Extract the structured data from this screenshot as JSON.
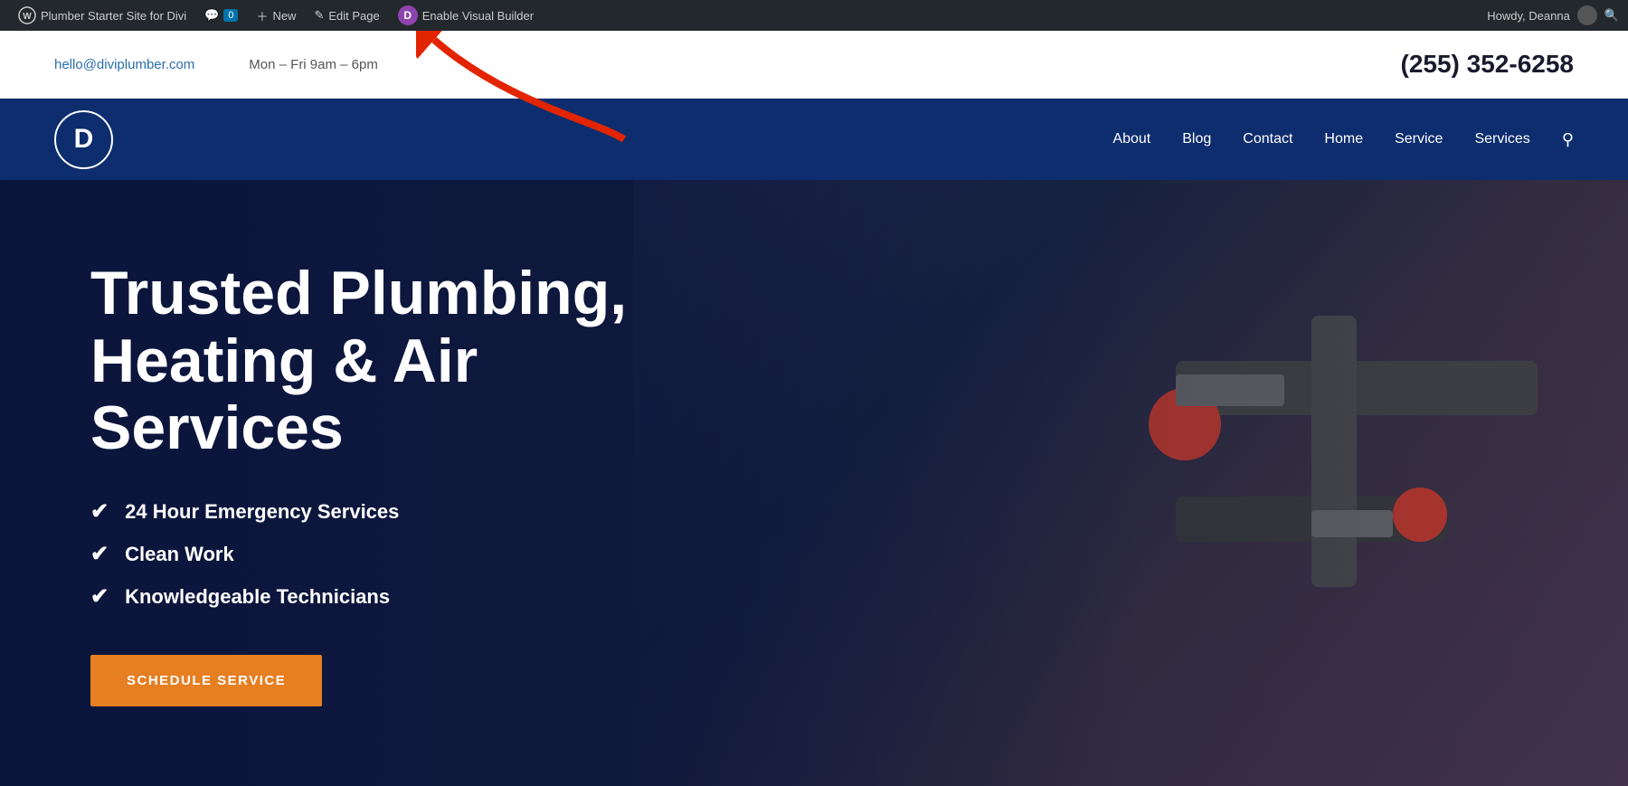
{
  "admin_bar": {
    "site_name": "Plumber Starter Site for Divi",
    "comments_label": "0",
    "new_label": "New",
    "edit_page_label": "Edit Page",
    "visual_builder_label": "Enable Visual Builder",
    "howdy_label": "Howdy, Deanna",
    "divi_letter": "D",
    "wp_icon": "⊕"
  },
  "top_bar": {
    "email": "hello@diviplumber.com",
    "hours": "Mon – Fri 9am – 6pm",
    "phone": "(255) 352-6258"
  },
  "nav": {
    "logo_letter": "D",
    "links": [
      {
        "label": "About",
        "href": "#"
      },
      {
        "label": "Blog",
        "href": "#"
      },
      {
        "label": "Contact",
        "href": "#"
      },
      {
        "label": "Home",
        "href": "#"
      },
      {
        "label": "Service",
        "href": "#"
      },
      {
        "label": "Services",
        "href": "#"
      }
    ],
    "search_icon": "🔍"
  },
  "hero": {
    "title": "Trusted Plumbing, Heating & Air Services",
    "features": [
      "24 Hour Emergency Services",
      "Clean Work",
      "Knowledgeable Technicians"
    ],
    "cta_label": "SCHEDULE SERVICE"
  },
  "arrow": {
    "annotation": "red arrow pointing to Enable Visual Builder"
  }
}
